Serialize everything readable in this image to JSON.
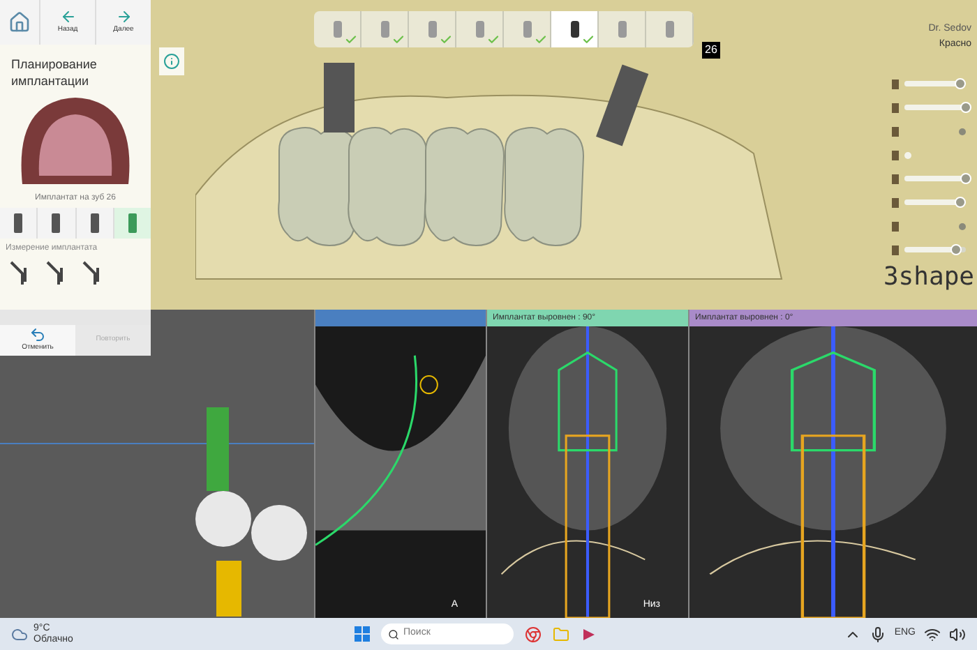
{
  "nav": {
    "back": "Назад",
    "next": "Далее"
  },
  "panel": {
    "title": "Планирование имплантации",
    "implant_label": "Имплантат на зуб 26",
    "measure_title": "Измерение имплантата",
    "tools": [
      {
        "selected": false
      },
      {
        "selected": false
      },
      {
        "selected": false
      },
      {
        "selected": true
      }
    ],
    "undo": {
      "label": "Отменить",
      "disabled": false
    },
    "redo": {
      "label": "Повторить",
      "disabled": true
    }
  },
  "workflow_steps": [
    {
      "done": true,
      "selected": false
    },
    {
      "done": true,
      "selected": false
    },
    {
      "done": true,
      "selected": false
    },
    {
      "done": true,
      "selected": false
    },
    {
      "done": true,
      "selected": false
    },
    {
      "done": true,
      "selected": true
    },
    {
      "done": false,
      "selected": false
    },
    {
      "done": false,
      "selected": false
    }
  ],
  "implant_tag": "26",
  "user": {
    "name": "Dr. Sedov",
    "line_2": "Красно"
  },
  "visibility": [
    {
      "kind": "slider",
      "level": 0.9
    },
    {
      "kind": "slider",
      "level": 1
    },
    {
      "kind": "switch",
      "on": true
    },
    {
      "kind": "switch",
      "on": false
    },
    {
      "kind": "slider",
      "level": 1
    },
    {
      "kind": "slider",
      "level": 0.9
    },
    {
      "kind": "switch",
      "on": true
    },
    {
      "kind": "slider",
      "level": 0.85
    }
  ],
  "logo": "3shape",
  "views": [
    {
      "kind": "panorama"
    },
    {
      "kind": "axial",
      "color": "#4a7fc0",
      "label": "A"
    },
    {
      "kind": "cross",
      "color": "#7fd6b0",
      "title": "Имплантат выровнен : 90°",
      "label": "Низ"
    },
    {
      "kind": "cross",
      "color": "#a98bc9",
      "title": "Имплантат выровнен : 0°"
    }
  ],
  "taskbar": {
    "temperature": "9°C",
    "weather": "Облачно",
    "search_placeholder": "Поиск",
    "language": "ENG"
  }
}
